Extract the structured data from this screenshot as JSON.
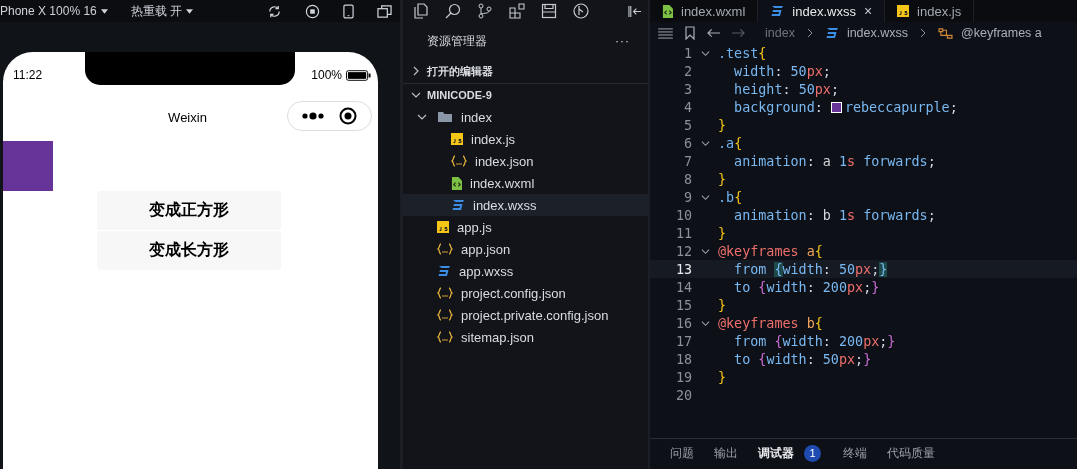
{
  "simulator": {
    "device": "Phone X 100% 16",
    "hot_reload": "热重载 开",
    "phone": {
      "time": "11:22",
      "battery": "100%",
      "nav_title": "Weixin",
      "buttons": [
        "变成正方形",
        "变成长方形"
      ]
    }
  },
  "explorer": {
    "title": "资源管理器",
    "more": "···",
    "sections": [
      {
        "label": "打开的编辑器",
        "expanded": false
      },
      {
        "label": "MINICODE-9",
        "expanded": true,
        "children": [
          {
            "label": "index",
            "kind": "folder",
            "expanded": true,
            "selected": false,
            "children": [
              {
                "label": "index.js",
                "kind": "js",
                "selected": false
              },
              {
                "label": "index.json",
                "kind": "json",
                "selected": false
              },
              {
                "label": "index.wxml",
                "kind": "wxml",
                "selected": false
              },
              {
                "label": "index.wxss",
                "kind": "css",
                "selected": true
              }
            ]
          },
          {
            "label": "app.js",
            "kind": "js",
            "selected": false
          },
          {
            "label": "app.json",
            "kind": "json",
            "selected": false
          },
          {
            "label": "app.wxss",
            "kind": "css",
            "selected": false
          },
          {
            "label": "project.config.json",
            "kind": "json",
            "selected": false
          },
          {
            "label": "project.private.config.json",
            "kind": "json",
            "selected": false
          },
          {
            "label": "sitemap.json",
            "kind": "json",
            "selected": false
          }
        ]
      }
    ]
  },
  "editor": {
    "tabs": [
      {
        "label": "index.wxml",
        "kind": "wxml",
        "selected": false
      },
      {
        "label": "index.wxss",
        "kind": "css",
        "selected": true,
        "close": "×"
      },
      {
        "label": "index.js",
        "kind": "js",
        "selected": false
      }
    ],
    "breadcrumb": [
      {
        "label": "index",
        "kind": "folder"
      },
      {
        "label": "index.wxss",
        "kind": "css"
      },
      {
        "label": "@keyframes a",
        "kind": "symbol"
      }
    ],
    "lines": [
      {
        "number": "1",
        "foldable": true,
        "current": false,
        "tokens": [
          {
            "text": ".test",
            "kind": "sel"
          },
          {
            "text": "{",
            "kind": "brace"
          }
        ]
      },
      {
        "number": "2",
        "foldable": false,
        "current": false,
        "tokens": [
          {
            "text": "  width",
            "kind": "prop"
          },
          {
            "text": ": ",
            "kind": "punct"
          },
          {
            "text": "50",
            "kind": "num"
          },
          {
            "text": "px",
            "kind": "unit"
          },
          {
            "text": ";",
            "kind": "punct"
          }
        ]
      },
      {
        "number": "3",
        "foldable": false,
        "current": false,
        "tokens": [
          {
            "text": "  height",
            "kind": "prop"
          },
          {
            "text": ": ",
            "kind": "punct"
          },
          {
            "text": "50",
            "kind": "num"
          },
          {
            "text": "px",
            "kind": "unit"
          },
          {
            "text": ";",
            "kind": "punct"
          }
        ]
      },
      {
        "number": "4",
        "foldable": false,
        "current": false,
        "tokens": [
          {
            "text": "  background",
            "kind": "prop"
          },
          {
            "text": ": ",
            "kind": "punct"
          },
          {
            "kind": "swatch",
            "color": "#663399"
          },
          {
            "text": "rebeccapurple",
            "kind": "val"
          },
          {
            "text": ";",
            "kind": "punct"
          }
        ]
      },
      {
        "number": "5",
        "foldable": false,
        "current": false,
        "tokens": [
          {
            "text": "}",
            "kind": "brace"
          }
        ]
      },
      {
        "number": "6",
        "foldable": true,
        "current": false,
        "tokens": [
          {
            "text": ".a",
            "kind": "sel"
          },
          {
            "text": "{",
            "kind": "brace"
          }
        ]
      },
      {
        "number": "7",
        "foldable": false,
        "current": false,
        "tokens": [
          {
            "text": "  animation",
            "kind": "prop"
          },
          {
            "text": ": a ",
            "kind": "punct"
          },
          {
            "text": "1",
            "kind": "num"
          },
          {
            "text": "s ",
            "kind": "unit"
          },
          {
            "text": "forwards",
            "kind": "val"
          },
          {
            "text": ";",
            "kind": "punct"
          }
        ]
      },
      {
        "number": "8",
        "foldable": false,
        "current": false,
        "tokens": [
          {
            "text": "}",
            "kind": "brace"
          }
        ]
      },
      {
        "number": "9",
        "foldable": true,
        "current": false,
        "tokens": [
          {
            "text": ".b",
            "kind": "sel"
          },
          {
            "text": "{",
            "kind": "brace"
          }
        ]
      },
      {
        "number": "10",
        "foldable": false,
        "current": false,
        "tokens": [
          {
            "text": "  animation",
            "kind": "prop"
          },
          {
            "text": ": b ",
            "kind": "punct"
          },
          {
            "text": "1",
            "kind": "num"
          },
          {
            "text": "s ",
            "kind": "unit"
          },
          {
            "text": "forwards",
            "kind": "val"
          },
          {
            "text": ";",
            "kind": "punct"
          }
        ]
      },
      {
        "number": "11",
        "foldable": false,
        "current": false,
        "tokens": [
          {
            "text": "}",
            "kind": "brace"
          }
        ]
      },
      {
        "number": "12",
        "foldable": true,
        "current": false,
        "tokens": [
          {
            "text": "@keyframes ",
            "kind": "at"
          },
          {
            "text": "a",
            "kind": "name"
          },
          {
            "text": "{",
            "kind": "brace"
          }
        ]
      },
      {
        "number": "13",
        "foldable": false,
        "current": true,
        "tokens": [
          {
            "text": "  from ",
            "kind": "prop"
          },
          {
            "text": "{",
            "kind": "match"
          },
          {
            "text": "width",
            "kind": "prop"
          },
          {
            "text": ": ",
            "kind": "punct"
          },
          {
            "text": "50",
            "kind": "num"
          },
          {
            "text": "px",
            "kind": "unit"
          },
          {
            "text": ";",
            "kind": "punct"
          },
          {
            "text": "}",
            "kind": "match"
          }
        ]
      },
      {
        "number": "14",
        "foldable": false,
        "current": false,
        "tokens": [
          {
            "text": "  to ",
            "kind": "prop"
          },
          {
            "text": "{",
            "kind": "pbrace"
          },
          {
            "text": "width",
            "kind": "prop"
          },
          {
            "text": ": ",
            "kind": "punct"
          },
          {
            "text": "200",
            "kind": "num"
          },
          {
            "text": "px",
            "kind": "unit"
          },
          {
            "text": ";",
            "kind": "punct"
          },
          {
            "text": "}",
            "kind": "pbrace"
          }
        ]
      },
      {
        "number": "15",
        "foldable": false,
        "current": false,
        "tokens": [
          {
            "text": "}",
            "kind": "brace"
          }
        ]
      },
      {
        "number": "16",
        "foldable": true,
        "current": false,
        "tokens": [
          {
            "text": "@keyframes ",
            "kind": "at"
          },
          {
            "text": "b",
            "kind": "name"
          },
          {
            "text": "{",
            "kind": "brace"
          }
        ]
      },
      {
        "number": "17",
        "foldable": false,
        "current": false,
        "tokens": [
          {
            "text": "  from ",
            "kind": "prop"
          },
          {
            "text": "{",
            "kind": "pbrace"
          },
          {
            "text": "width",
            "kind": "prop"
          },
          {
            "text": ": ",
            "kind": "punct"
          },
          {
            "text": "200",
            "kind": "num"
          },
          {
            "text": "px",
            "kind": "unit"
          },
          {
            "text": ";",
            "kind": "punct"
          },
          {
            "text": "}",
            "kind": "pbrace"
          }
        ]
      },
      {
        "number": "18",
        "foldable": false,
        "current": false,
        "tokens": [
          {
            "text": "  to ",
            "kind": "prop"
          },
          {
            "text": "{",
            "kind": "pbrace"
          },
          {
            "text": "width",
            "kind": "prop"
          },
          {
            "text": ": ",
            "kind": "punct"
          },
          {
            "text": "50",
            "kind": "num"
          },
          {
            "text": "px",
            "kind": "unit"
          },
          {
            "text": ";",
            "kind": "punct"
          },
          {
            "text": "}",
            "kind": "pbrace"
          }
        ]
      },
      {
        "number": "19",
        "foldable": false,
        "current": false,
        "tokens": [
          {
            "text": "}",
            "kind": "brace"
          }
        ]
      },
      {
        "number": "20",
        "foldable": false,
        "current": false
      }
    ]
  },
  "panel": {
    "tabs": [
      {
        "label": "问题",
        "selected": false
      },
      {
        "label": "输出",
        "selected": false
      },
      {
        "label": "调试器",
        "selected": true,
        "badge": "1"
      },
      {
        "label": "终端",
        "selected": false
      },
      {
        "label": "代码质量",
        "selected": false
      }
    ]
  }
}
